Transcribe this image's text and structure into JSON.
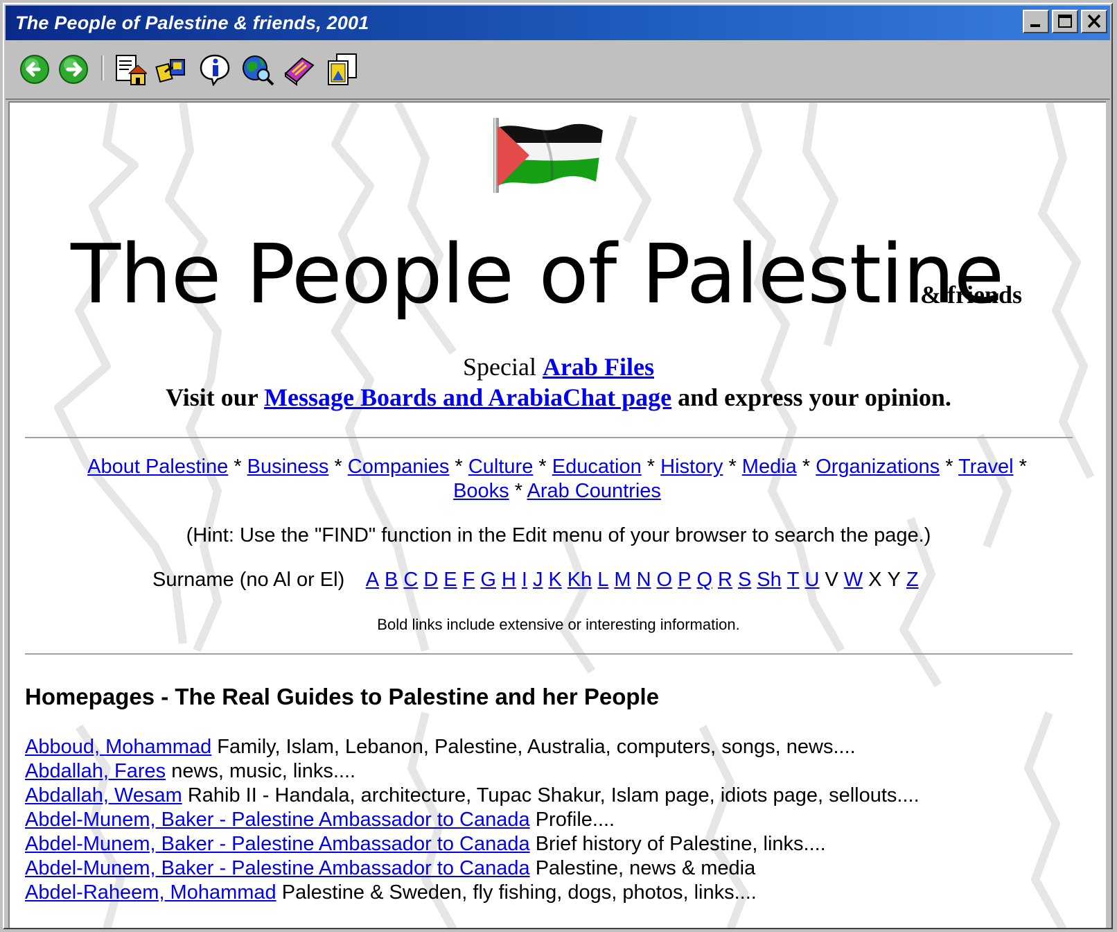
{
  "window": {
    "title": "The People of Palestine & friends, 2001"
  },
  "toolbar": {
    "buttons": [
      {
        "name": "back-arrow-icon"
      },
      {
        "name": "forward-arrow-icon"
      },
      {
        "name": "home-page-icon"
      },
      {
        "name": "links-icon"
      },
      {
        "name": "info-icon"
      },
      {
        "name": "globe-search-icon"
      },
      {
        "name": "book-icon"
      },
      {
        "name": "pictures-icon"
      }
    ]
  },
  "header": {
    "title_main": "The People of Palestine",
    "title_sub": "& friends"
  },
  "special": {
    "prefix": "Special",
    "link": "Arab Files"
  },
  "visit": {
    "prefix": "Visit our",
    "link": "Message Boards and ArabiaChat page",
    "suffix": "and express your opinion."
  },
  "nav": {
    "items": [
      "About Palestine",
      "Business",
      "Companies",
      "Culture",
      "Education",
      "History",
      "Media",
      "Organizations",
      "Travel",
      "Books",
      "Arab Countries"
    ],
    "separator": "*"
  },
  "hint": "(Hint: Use the \"FIND\" function in the Edit menu of your browser to search the page.)",
  "surname": {
    "label": "Surname (no Al or El)",
    "letters": [
      {
        "t": "A",
        "link": true
      },
      {
        "t": "B",
        "link": true
      },
      {
        "t": "C",
        "link": true
      },
      {
        "t": "D",
        "link": true
      },
      {
        "t": "E",
        "link": true
      },
      {
        "t": "F",
        "link": true
      },
      {
        "t": "G",
        "link": true
      },
      {
        "t": "H",
        "link": true
      },
      {
        "t": "I",
        "link": true
      },
      {
        "t": "J",
        "link": true
      },
      {
        "t": "K",
        "link": true
      },
      {
        "t": "Kh",
        "link": true
      },
      {
        "t": "L",
        "link": true
      },
      {
        "t": "M",
        "link": true
      },
      {
        "t": "N",
        "link": true
      },
      {
        "t": "O",
        "link": true
      },
      {
        "t": "P",
        "link": true
      },
      {
        "t": "Q",
        "link": true
      },
      {
        "t": "R",
        "link": true
      },
      {
        "t": "S",
        "link": true
      },
      {
        "t": "Sh",
        "link": true
      },
      {
        "t": "T",
        "link": true
      },
      {
        "t": "U",
        "link": true
      },
      {
        "t": "V",
        "link": false
      },
      {
        "t": "W",
        "link": true
      },
      {
        "t": "X",
        "link": false
      },
      {
        "t": "Y",
        "link": false
      },
      {
        "t": "Z",
        "link": true
      }
    ]
  },
  "bold_note": "Bold links include extensive or interesting information.",
  "section": {
    "title": "Homepages - The Real Guides to Palestine and her People"
  },
  "entries": [
    {
      "name": "Abboud, Mohammad",
      "desc": "Family, Islam, Lebanon, Palestine, Australia, computers, songs, news...."
    },
    {
      "name": "Abdallah, Fares",
      "desc": "news, music, links...."
    },
    {
      "name": "Abdallah, Wesam",
      "desc": "Rahib II - Handala, architecture, Tupac Shakur, Islam page, idiots page, sellouts...."
    },
    {
      "name": "Abdel-Munem, Baker - Palestine Ambassador to Canada",
      "desc": "Profile...."
    },
    {
      "name": "Abdel-Munem, Baker - Palestine Ambassador to Canada",
      "desc": "Brief history of Palestine, links...."
    },
    {
      "name": "Abdel-Munem, Baker - Palestine Ambassador to Canada",
      "desc": "Palestine, news & media"
    },
    {
      "name": "Abdel-Raheem, Mohammad",
      "desc": "Palestine & Sweden, fly fishing, dogs, photos, links...."
    }
  ]
}
